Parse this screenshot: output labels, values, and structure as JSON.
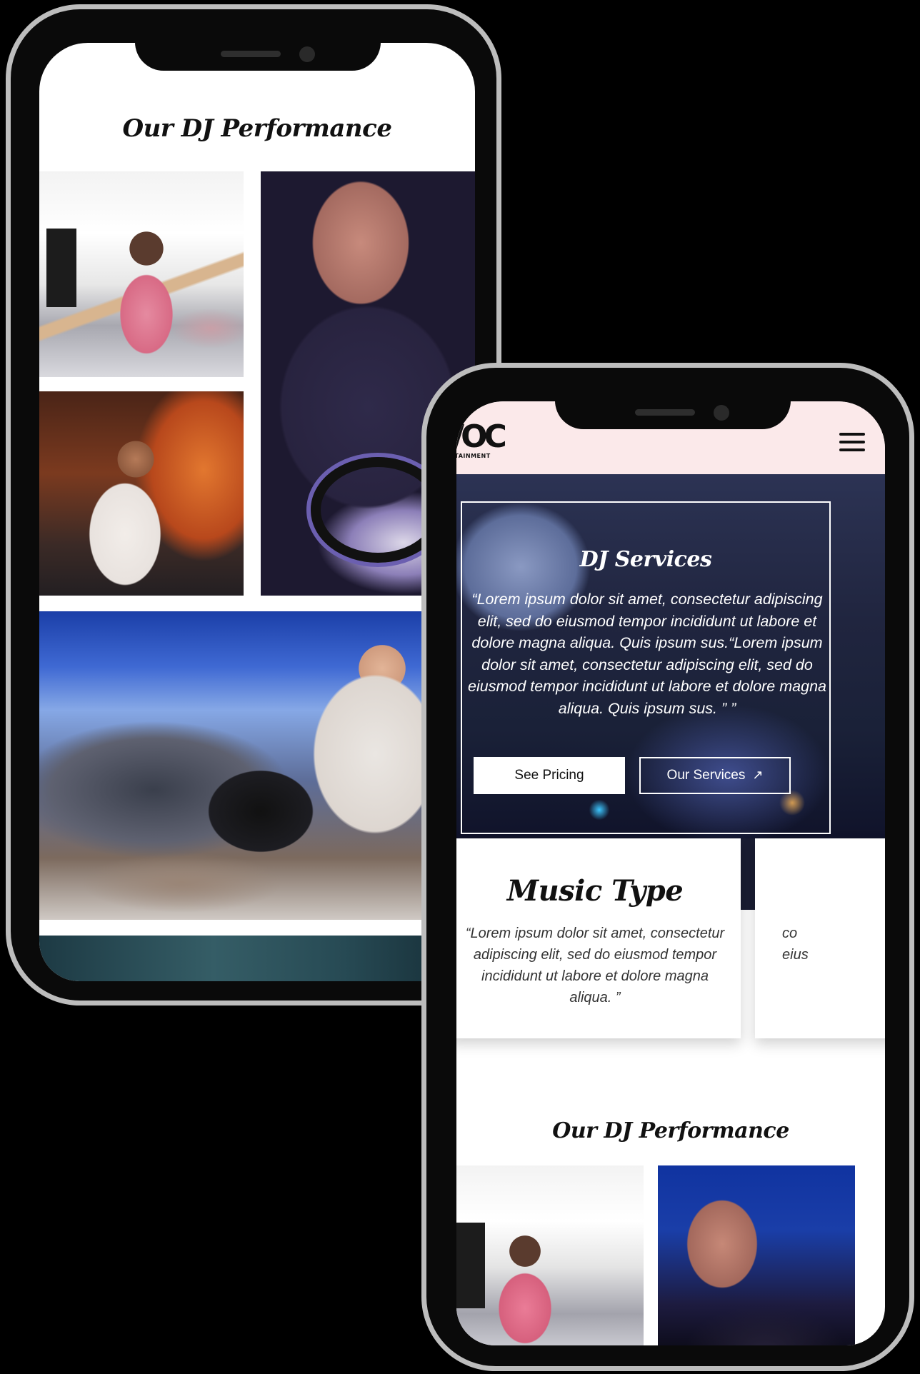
{
  "phone_left": {
    "section_title": "Our DJ Performance",
    "gallery": [
      {
        "name": "dj-arm-raised-photo"
      },
      {
        "name": "dj-purple-tee-photo"
      },
      {
        "name": "dj-brick-wall-photo"
      },
      {
        "name": "tent-dance-floor-photo"
      },
      {
        "name": "next-photo-strip"
      }
    ]
  },
  "phone_right": {
    "header": {
      "logo_mark": "A/OC",
      "logo_sub": "ENTERTAINMENT",
      "menu_icon": "hamburger-menu-icon",
      "background": "#fbe9ea"
    },
    "hero": {
      "title": "DJ Services",
      "text": "“Lorem ipsum dolor sit amet, consectetur adipiscing elit, sed do eiusmod tempor incididunt ut labore et dolore magna aliqua. Quis ipsum sus.“Lorem ipsum dolor sit amet, consectetur adipiscing elit, sed do eiusmod tempor incididunt ut labore et dolore magna aliqua. Quis ipsum sus. ” ”",
      "primary_button": "See Pricing",
      "secondary_button": "Our Services",
      "secondary_icon": "arrow-up-right-icon"
    },
    "cards": [
      {
        "title": "Music Type",
        "text": "“Lorem ipsum dolor sit amet, consectetur adipiscing elit, sed do eiusmod tempor incididunt ut labore et dolore magna aliqua. ”"
      },
      {
        "text_fragment_1": "co",
        "text_fragment_2": "eius"
      }
    ],
    "performance_title": "Our DJ Performance"
  }
}
